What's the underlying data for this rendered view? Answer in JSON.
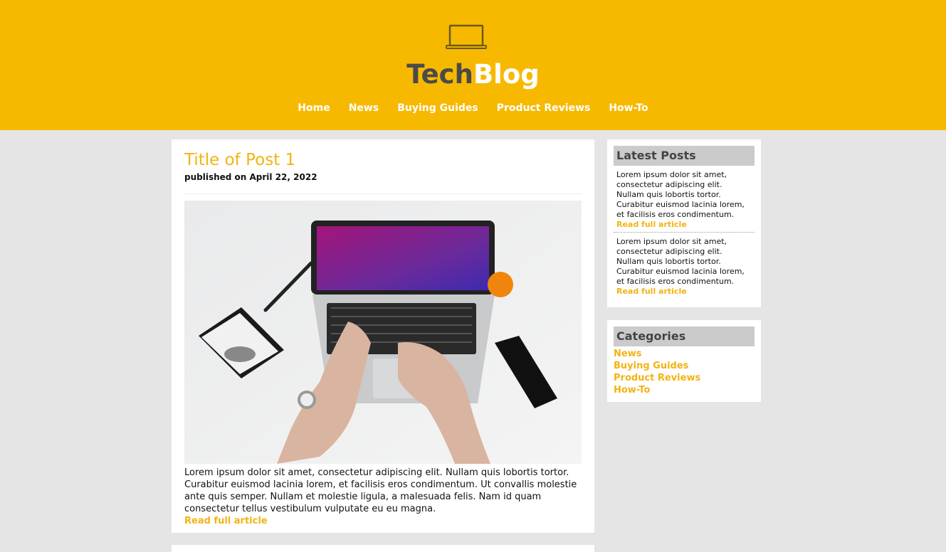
{
  "header": {
    "icon": "laptop-icon",
    "logo_part1": "Tech",
    "logo_part2": "Blog",
    "colors": {
      "header_bg": "#f7b900",
      "accent": "#f3b312",
      "logo_dark": "#4a4a4a"
    }
  },
  "nav": {
    "items": [
      {
        "label": "Home"
      },
      {
        "label": "News"
      },
      {
        "label": "Buying Guides"
      },
      {
        "label": "Product Reviews"
      },
      {
        "label": "How-To"
      }
    ]
  },
  "post": {
    "title": "Title of Post 1",
    "date": "published on April 22, 2022",
    "image_description_icon": "laptop-desk-photo",
    "body": "Lorem ipsum dolor sit amet, consectetur adipiscing elit. Nullam quis lobortis tortor. Curabitur euismod lacinia lorem, et facilisis eros condimentum. Ut convallis molestie ante quis semper. Nullam et molestie ligula, a malesuada felis. Nam id quam consectetur tellus vestibulum vulputate eu eu magna.",
    "read_more": "Read full article"
  },
  "latest_posts": {
    "heading": "Latest Posts",
    "items": [
      {
        "text": "Lorem ipsum dolor sit amet, consectetur adipiscing elit. Nullam quis lobortis tortor. Curabitur euismod lacinia lorem, et facilisis eros condimentum.",
        "link": "Read full article"
      },
      {
        "text": "Lorem ipsum dolor sit amet, consectetur adipiscing elit. Nullam quis lobortis tortor. Curabitur euismod lacinia lorem, et facilisis eros condimentum.",
        "link": "Read full article"
      }
    ]
  },
  "categories": {
    "heading": "Categories",
    "items": [
      {
        "label": "News"
      },
      {
        "label": "Buying Guides"
      },
      {
        "label": "Product Reviews"
      },
      {
        "label": "How-To"
      }
    ]
  }
}
